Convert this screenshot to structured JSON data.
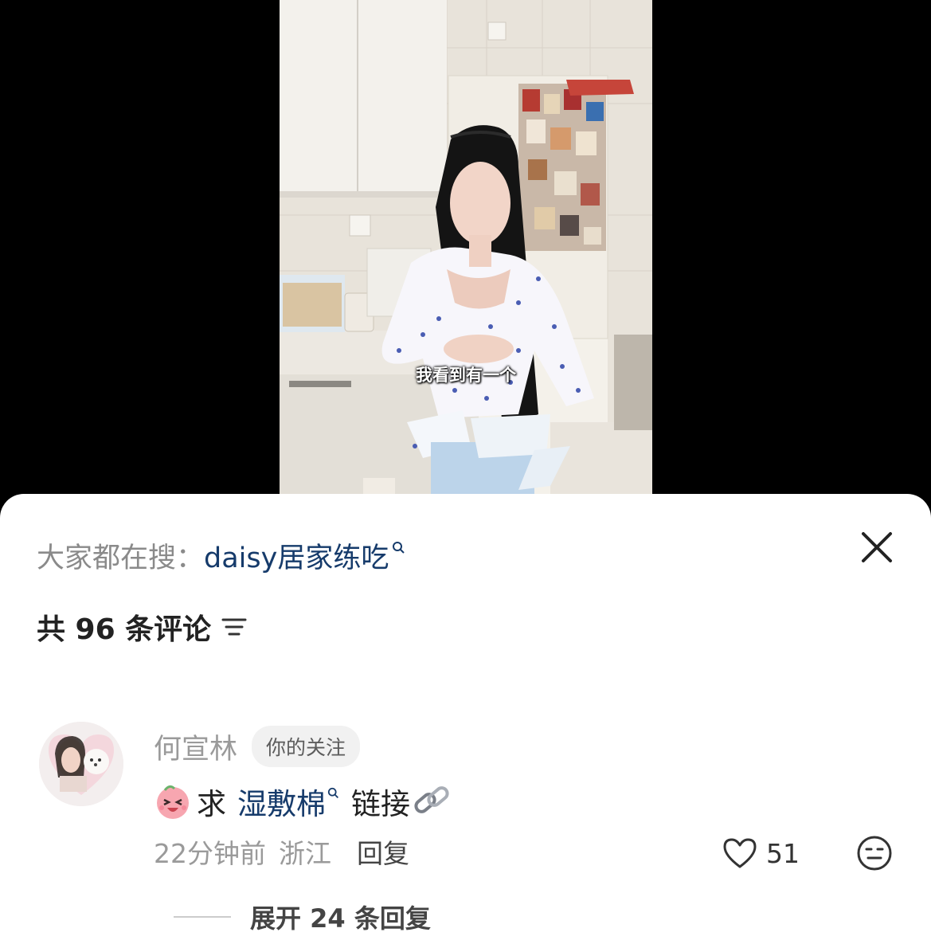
{
  "video": {
    "subtitle": "我看到有一个"
  },
  "comments_panel": {
    "search": {
      "prefix": "大家都在搜：",
      "term": "daisy居家练吃"
    },
    "count_text": "共 96 条评论",
    "comment": {
      "author": "何宣林",
      "badge": "你的关注",
      "text_prefix": "求",
      "link_text": "湿敷棉",
      "text_suffix": "链接",
      "time": "22分钟前",
      "location": "浙江",
      "reply_label": "回复",
      "likes": "51",
      "expand_label": "展开 24 条回复"
    }
  },
  "colors": {
    "link": "#163b6b",
    "muted": "#9a9a9a",
    "badge_bg": "#f1f1f1"
  },
  "icons": [
    "search-hint-icon",
    "close-icon",
    "sort-icon",
    "emoji-sticker-icon",
    "chain-link-icon",
    "heart-icon",
    "emoji-face-icon"
  ]
}
